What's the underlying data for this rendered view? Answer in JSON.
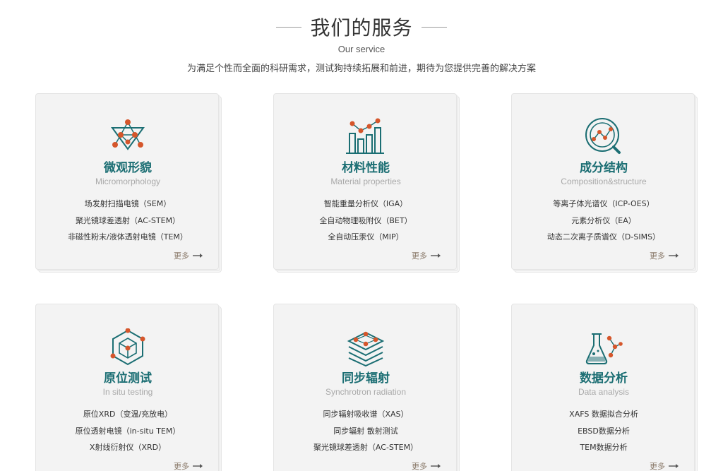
{
  "header": {
    "title": "我们的服务",
    "subtitle_en": "Our service",
    "description": "为满足个性而全面的科研需求，测试狗持续拓展和前进，期待为您提供完善的解决方案"
  },
  "colors": {
    "teal": "#1b6e73",
    "orange": "#d5562b",
    "card_bg": "#f3f3f3"
  },
  "cards": [
    {
      "icon": "triangle-molecule-icon",
      "title": "微观形貌",
      "subtitle": "Micromorphology",
      "items": [
        "场发射扫描电镜（SEM）",
        "聚光镜球差透射（AC-STEM）",
        "非磁性粉末/液体透射电镜（TEM）"
      ],
      "more": "更多"
    },
    {
      "icon": "bar-chart-icon",
      "title": "材料性能",
      "subtitle": "Material properties",
      "items": [
        "智能重量分析仪（IGA）",
        "全自动物理吸附仪（BET）",
        "全自动压汞仪（MIP）"
      ],
      "more": "更多"
    },
    {
      "icon": "magnifier-chart-icon",
      "title": "成分结构",
      "subtitle": "Composition&structure",
      "items": [
        "等离子体光谱仪（ICP-OES）",
        "元素分析仪（EA）",
        "动态二次离子质谱仪（D-SIMS）"
      ],
      "more": "更多"
    },
    {
      "icon": "hexagon-cube-icon",
      "title": "原位测试",
      "subtitle": "In situ testing",
      "items": [
        "原位XRD（变温/充放电）",
        "原位透射电镜（in-situ TEM）",
        "X射线衍射仪（XRD）"
      ],
      "more": "更多"
    },
    {
      "icon": "layers-icon",
      "title": "同步辐射",
      "subtitle": "Synchrotron radiation",
      "items": [
        "同步辐射吸收谱（XAS）",
        "同步辐射 散射测试",
        "聚光镜球差透射（AC-STEM）"
      ],
      "more": "更多"
    },
    {
      "icon": "flask-molecule-icon",
      "title": "数据分析",
      "subtitle": "Data analysis",
      "items": [
        "XAFS 数据拟合分析",
        "EBSD数据分析",
        "TEM数据分析"
      ],
      "more": "更多"
    }
  ]
}
